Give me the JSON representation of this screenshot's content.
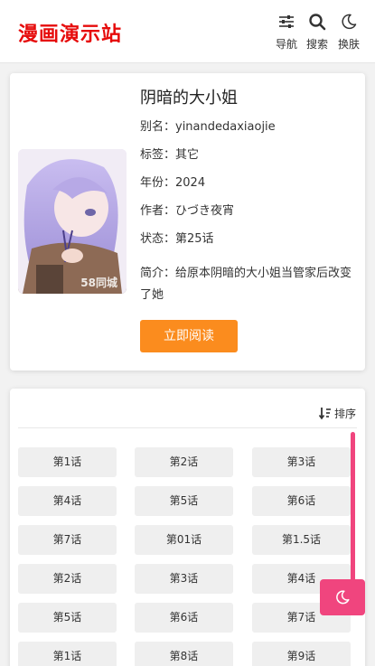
{
  "header": {
    "logo": "漫画演示站",
    "nav": [
      {
        "label": "导航",
        "icon": "sliders-icon"
      },
      {
        "label": "搜索",
        "icon": "search-icon"
      },
      {
        "label": "换肤",
        "icon": "moon-icon"
      }
    ]
  },
  "comic": {
    "title": "阴暗的大小姐",
    "alias": "别名：yinandedaxiaojie",
    "tags": "标签：其它",
    "year": "年份：2024",
    "author": "作者：ひづき夜宵",
    "status": "状态：第25话",
    "intro": "简介：给原本阴暗的大小姐当管家后改变了她",
    "read_label": "立即阅读",
    "cover_watermark": "58同城"
  },
  "chapters": {
    "sort_label": "排序",
    "items": [
      "第1话",
      "第2话",
      "第3话",
      "第4话",
      "第5话",
      "第6话",
      "第7话",
      "第01话",
      "第1.5话",
      "第2话",
      "第3话",
      "第4话",
      "第5话",
      "第6话",
      "第7话",
      "第1话",
      "第8话",
      "第9话"
    ]
  },
  "colors": {
    "logo": "#e60b0b",
    "read_button": "#fb8c1e",
    "accent_pink": "#f0457e"
  }
}
